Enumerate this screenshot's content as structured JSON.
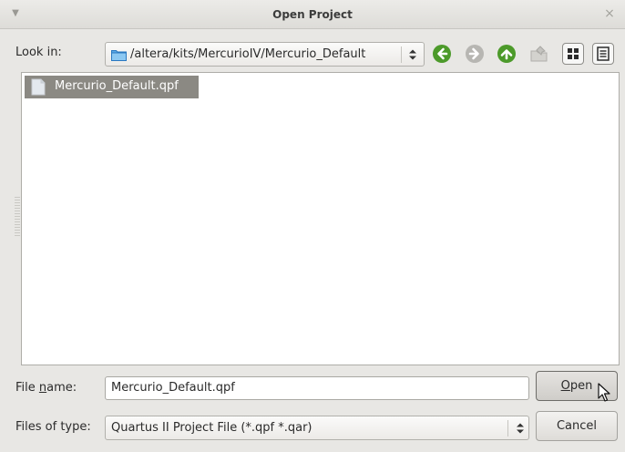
{
  "window": {
    "title": "Open Project",
    "menu_icon": "chevron-down-icon",
    "close_icon": "close-icon"
  },
  "toolbar": {
    "look_in_label": "Look in:",
    "path": "/altera/kits/MercurioIV/Mercurio_Default",
    "icons": [
      "back-icon",
      "forward-icon",
      "up-icon",
      "new-folder-icon",
      "icon-view-icon",
      "detail-view-icon"
    ]
  },
  "files": [
    {
      "name": "Mercurio_Default.qpf",
      "icon": "document-icon",
      "selected": true
    }
  ],
  "form": {
    "file_name_label_pre": "File ",
    "file_name_label_key": "n",
    "file_name_label_post": "ame:",
    "file_name_value": "Mercurio_Default.qpf",
    "files_of_type_label": "Files of type:",
    "files_of_type_value": "Quartus II Project File (*.qpf *.qar)"
  },
  "buttons": {
    "open_key": "O",
    "open_rest": "pen",
    "cancel": "Cancel"
  },
  "colors": {
    "selection": "#8b8983",
    "nav_green": "#4c9a2a",
    "folder_blue": "#3d8fd6"
  }
}
